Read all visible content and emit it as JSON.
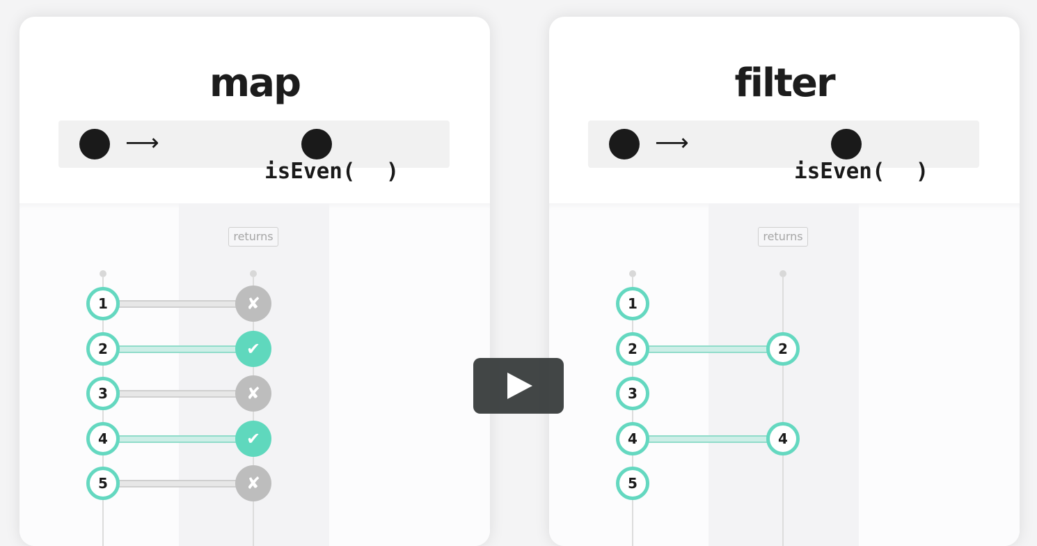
{
  "cards": {
    "map": {
      "title": "map",
      "signature": {
        "arrow": "⟶",
        "code_fn": "isEven(",
        "code_close": ")"
      },
      "returns_label": "returns",
      "inputs": [
        "1",
        "2",
        "3",
        "4",
        "5"
      ],
      "results": [
        {
          "kind": "false",
          "glyph": "✘"
        },
        {
          "kind": "true",
          "glyph": "✔"
        },
        {
          "kind": "false",
          "glyph": "✘"
        },
        {
          "kind": "true",
          "glyph": "✔"
        },
        {
          "kind": "false",
          "glyph": "✘"
        }
      ]
    },
    "filter": {
      "title": "filter",
      "signature": {
        "arrow": "⟶",
        "code_fn": "isEven(",
        "code_close": ")"
      },
      "returns_label": "returns",
      "inputs": [
        "1",
        "2",
        "3",
        "4",
        "5"
      ],
      "outputs": [
        {
          "input_index": 1,
          "value": "2"
        },
        {
          "input_index": 3,
          "value": "4"
        }
      ]
    }
  },
  "colors": {
    "accent_teal": "#64d8c0",
    "true_fill": "#5fd8bd",
    "false_fill": "#bdbdbd"
  },
  "video": {
    "play_icon": "play-icon"
  }
}
